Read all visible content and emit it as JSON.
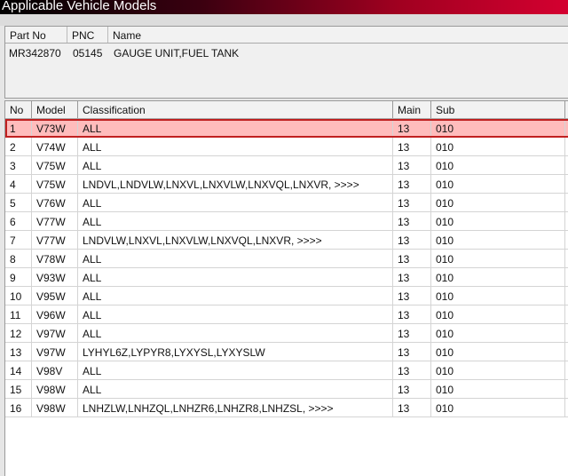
{
  "window": {
    "title": "Applicable Vehicle Models"
  },
  "part": {
    "headers": [
      "Part No",
      "PNC",
      "Name"
    ],
    "part_no": "MR342870",
    "pnc": "05145",
    "name": "GAUGE UNIT,FUEL TANK"
  },
  "grid": {
    "headers": [
      "No",
      "Model",
      "Classification",
      "Main",
      "Sub"
    ],
    "rows": [
      [
        "1",
        "V73W",
        "ALL",
        "13",
        "010"
      ],
      [
        "2",
        "V74W",
        "ALL",
        "13",
        "010"
      ],
      [
        "3",
        "V75W",
        "ALL",
        "13",
        "010"
      ],
      [
        "4",
        "V75W",
        "LNDVL,LNDVLW,LNXVL,LNXVLW,LNXVQL,LNXVR,  >>>>",
        "13",
        "010"
      ],
      [
        "5",
        "V76W",
        "ALL",
        "13",
        "010"
      ],
      [
        "6",
        "V77W",
        "ALL",
        "13",
        "010"
      ],
      [
        "7",
        "V77W",
        "LNDVLW,LNXVL,LNXVLW,LNXVQL,LNXVR,  >>>>",
        "13",
        "010"
      ],
      [
        "8",
        "V78W",
        "ALL",
        "13",
        "010"
      ],
      [
        "9",
        "V93W",
        "ALL",
        "13",
        "010"
      ],
      [
        "10",
        "V95W",
        "ALL",
        "13",
        "010"
      ],
      [
        "11",
        "V96W",
        "ALL",
        "13",
        "010"
      ],
      [
        "12",
        "V97W",
        "ALL",
        "13",
        "010"
      ],
      [
        "13",
        "V97W",
        "LYHYL6Z,LYPYR8,LYXYSL,LYXYSLW",
        "13",
        "010"
      ],
      [
        "14",
        "V98V",
        "ALL",
        "13",
        "010"
      ],
      [
        "15",
        "V98W",
        "ALL",
        "13",
        "010"
      ],
      [
        "16",
        "V98W",
        "LNHZLW,LNHZQL,LNHZR6,LNHZR8,LNHZSL,  >>>>",
        "13",
        "010"
      ]
    ],
    "selected_row": 0
  }
}
